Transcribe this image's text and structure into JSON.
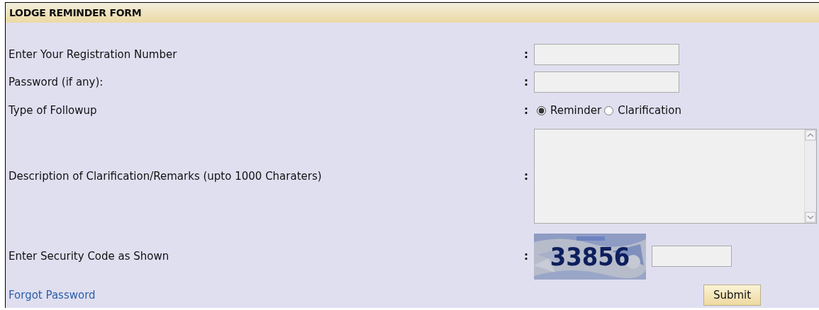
{
  "title": "LODGE REMINDER FORM",
  "rows": [
    {
      "kind": "text",
      "label": "Enter Your Registration Number",
      "separator": ":"
    },
    {
      "kind": "password",
      "label": "Password (if any):",
      "separator": ":"
    },
    {
      "kind": "radio",
      "label": "Type of Followup",
      "separator": ":",
      "options": [
        {
          "label": "Reminder",
          "selected": true
        },
        {
          "label": "Clarification",
          "selected": false
        }
      ]
    },
    {
      "kind": "textarea",
      "label": "Description of Clarification/Remarks (upto 1000 Charaters)",
      "separator": ":"
    },
    {
      "kind": "captcha",
      "label": "Enter Security Code as Shown",
      "separator": ":",
      "code": "33856"
    }
  ],
  "forgot_link": "Forgot Password",
  "submit": "Submit"
}
